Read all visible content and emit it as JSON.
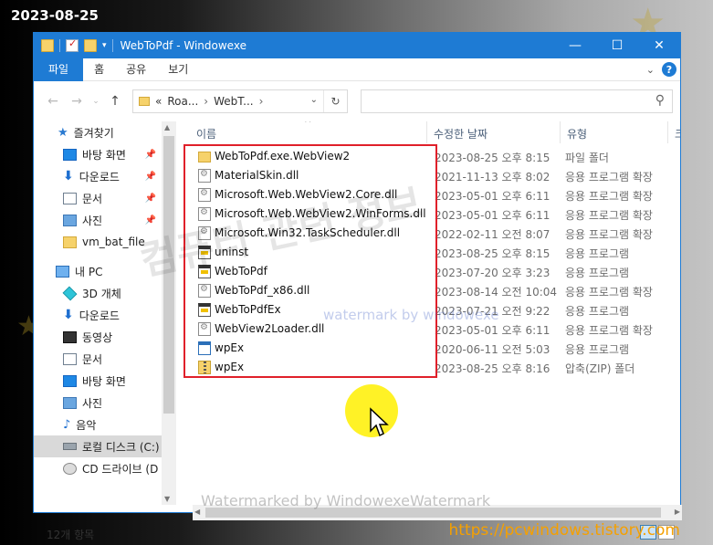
{
  "overlay": {
    "date": "2023-08-25",
    "url": "https://pcwindows.tistory.com",
    "watermark_korean": "컴퓨터 관련 정보",
    "watermark_mid": "watermark by windowexe",
    "watermark_bottom": "Watermarked by WindowexeWatermark"
  },
  "window": {
    "title": "WebToPdf  - Windowexe",
    "controls": {
      "minimize": "—",
      "maximize": "☐",
      "close": "✕"
    }
  },
  "ribbon": {
    "tabs": [
      "파일",
      "홈",
      "공유",
      "보기"
    ],
    "help": "?"
  },
  "address": {
    "segments": [
      "«",
      "Roa...",
      "›",
      "WebT...",
      "›"
    ],
    "search_placeholder": ""
  },
  "nav_pane": {
    "items": [
      {
        "label": "즐겨찾기",
        "icon": "star-icon",
        "pinned": false
      },
      {
        "label": "바탕 화면",
        "icon": "desktop-icon",
        "pinned": true
      },
      {
        "label": "다운로드",
        "icon": "download-icon",
        "pinned": true
      },
      {
        "label": "문서",
        "icon": "document-icon",
        "pinned": true
      },
      {
        "label": "사진",
        "icon": "pictures-icon",
        "pinned": true
      },
      {
        "label": "vm_bat_file",
        "icon": "folder-icon",
        "pinned": false
      },
      {
        "label": "내 PC",
        "icon": "pc-icon",
        "pinned": false
      },
      {
        "label": "3D 개체",
        "icon": "3d-objects-icon",
        "pinned": false
      },
      {
        "label": "다운로드",
        "icon": "download-icon",
        "pinned": false
      },
      {
        "label": "동영상",
        "icon": "video-icon",
        "pinned": false
      },
      {
        "label": "문서",
        "icon": "document-icon",
        "pinned": false
      },
      {
        "label": "바탕 화면",
        "icon": "desktop-icon",
        "pinned": false
      },
      {
        "label": "사진",
        "icon": "pictures-icon",
        "pinned": false
      },
      {
        "label": "음악",
        "icon": "music-icon",
        "pinned": false
      },
      {
        "label": "로컬 디스크 (C:)",
        "icon": "disk-icon",
        "pinned": false,
        "selected": true
      },
      {
        "label": "CD 드라이브 (D",
        "icon": "cd-drive-icon",
        "pinned": false
      }
    ]
  },
  "columns": {
    "name": "이름",
    "date": "수정한 날짜",
    "type": "유형",
    "size": "크"
  },
  "files": [
    {
      "name": "WebToPdf.exe.WebView2",
      "date": "2023-08-25 오후 8:15",
      "type": "파일 폴더",
      "icon": "folder-icon"
    },
    {
      "name": "MaterialSkin.dll",
      "date": "2021-11-13 오후 8:02",
      "type": "응용 프로그램 확장",
      "icon": "dll-icon"
    },
    {
      "name": "Microsoft.Web.WebView2.Core.dll",
      "date": "2023-05-01 오후 6:11",
      "type": "응용 프로그램 확장",
      "icon": "dll-icon"
    },
    {
      "name": "Microsoft.Web.WebView2.WinForms.dll",
      "date": "2023-05-01 오후 6:11",
      "type": "응용 프로그램 확장",
      "icon": "dll-icon"
    },
    {
      "name": "Microsoft.Win32.TaskScheduler.dll",
      "date": "2022-02-11 오전 8:07",
      "type": "응용 프로그램 확장",
      "icon": "dll-icon"
    },
    {
      "name": "uninst",
      "date": "2023-08-25 오후 8:15",
      "type": "응용 프로그램",
      "icon": "exe-icon"
    },
    {
      "name": "WebToPdf",
      "date": "2023-07-20 오후 3:23",
      "type": "응용 프로그램",
      "icon": "exe-icon"
    },
    {
      "name": "WebToPdf_x86.dll",
      "date": "2023-08-14 오전 10:04",
      "type": "응용 프로그램 확장",
      "icon": "dll-icon"
    },
    {
      "name": "WebToPdfEx",
      "date": "2023-07-21 오전 9:22",
      "type": "응용 프로그램",
      "icon": "exe-icon"
    },
    {
      "name": "WebView2Loader.dll",
      "date": "2023-05-01 오후 6:11",
      "type": "응용 프로그램 확장",
      "icon": "dll-icon"
    },
    {
      "name": "wpEx",
      "date": "2020-06-11 오전 5:03",
      "type": "응용 프로그램",
      "icon": "app-icon"
    },
    {
      "name": "wpEx",
      "date": "2023-08-25 오후 8:16",
      "type": "압축(ZIP) 폴더",
      "icon": "zip-icon"
    }
  ],
  "status": {
    "count": "12개 항목"
  },
  "colors": {
    "accent": "#1e7bd4",
    "highlight_box": "#e0202a",
    "url": "#f5a000",
    "cursor_halo": "#fff000"
  }
}
